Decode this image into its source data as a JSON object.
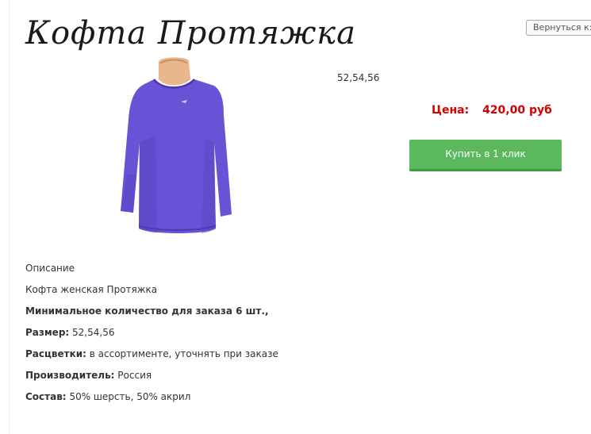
{
  "product": {
    "title": "Кофта Протяжка",
    "sizes_short": "52,54,56"
  },
  "navigation": {
    "back_label": "Вернуться к:"
  },
  "pricing": {
    "price_label": "Цена:",
    "price_value": "420,00 руб",
    "buy_button_label": "Купить в 1 клик"
  },
  "image": {
    "alt": "purple women's sweater on mannequin",
    "garment_color": "#6a52d6"
  },
  "description": {
    "heading": "Описание",
    "intro": "Кофта женская Протяжка",
    "min_order": "Минимальное количество для заказа 6 шт.,",
    "size_label": "Размер:",
    "size_value": "52,54,56",
    "colors_label": "Расцветки:",
    "colors_value": "в ассортименте, уточнять при заказе",
    "maker_label": "Производитель:",
    "maker_value": "Россия",
    "composition_label": "Состав:",
    "composition_value": "50% шерсть, 50% акрил"
  }
}
